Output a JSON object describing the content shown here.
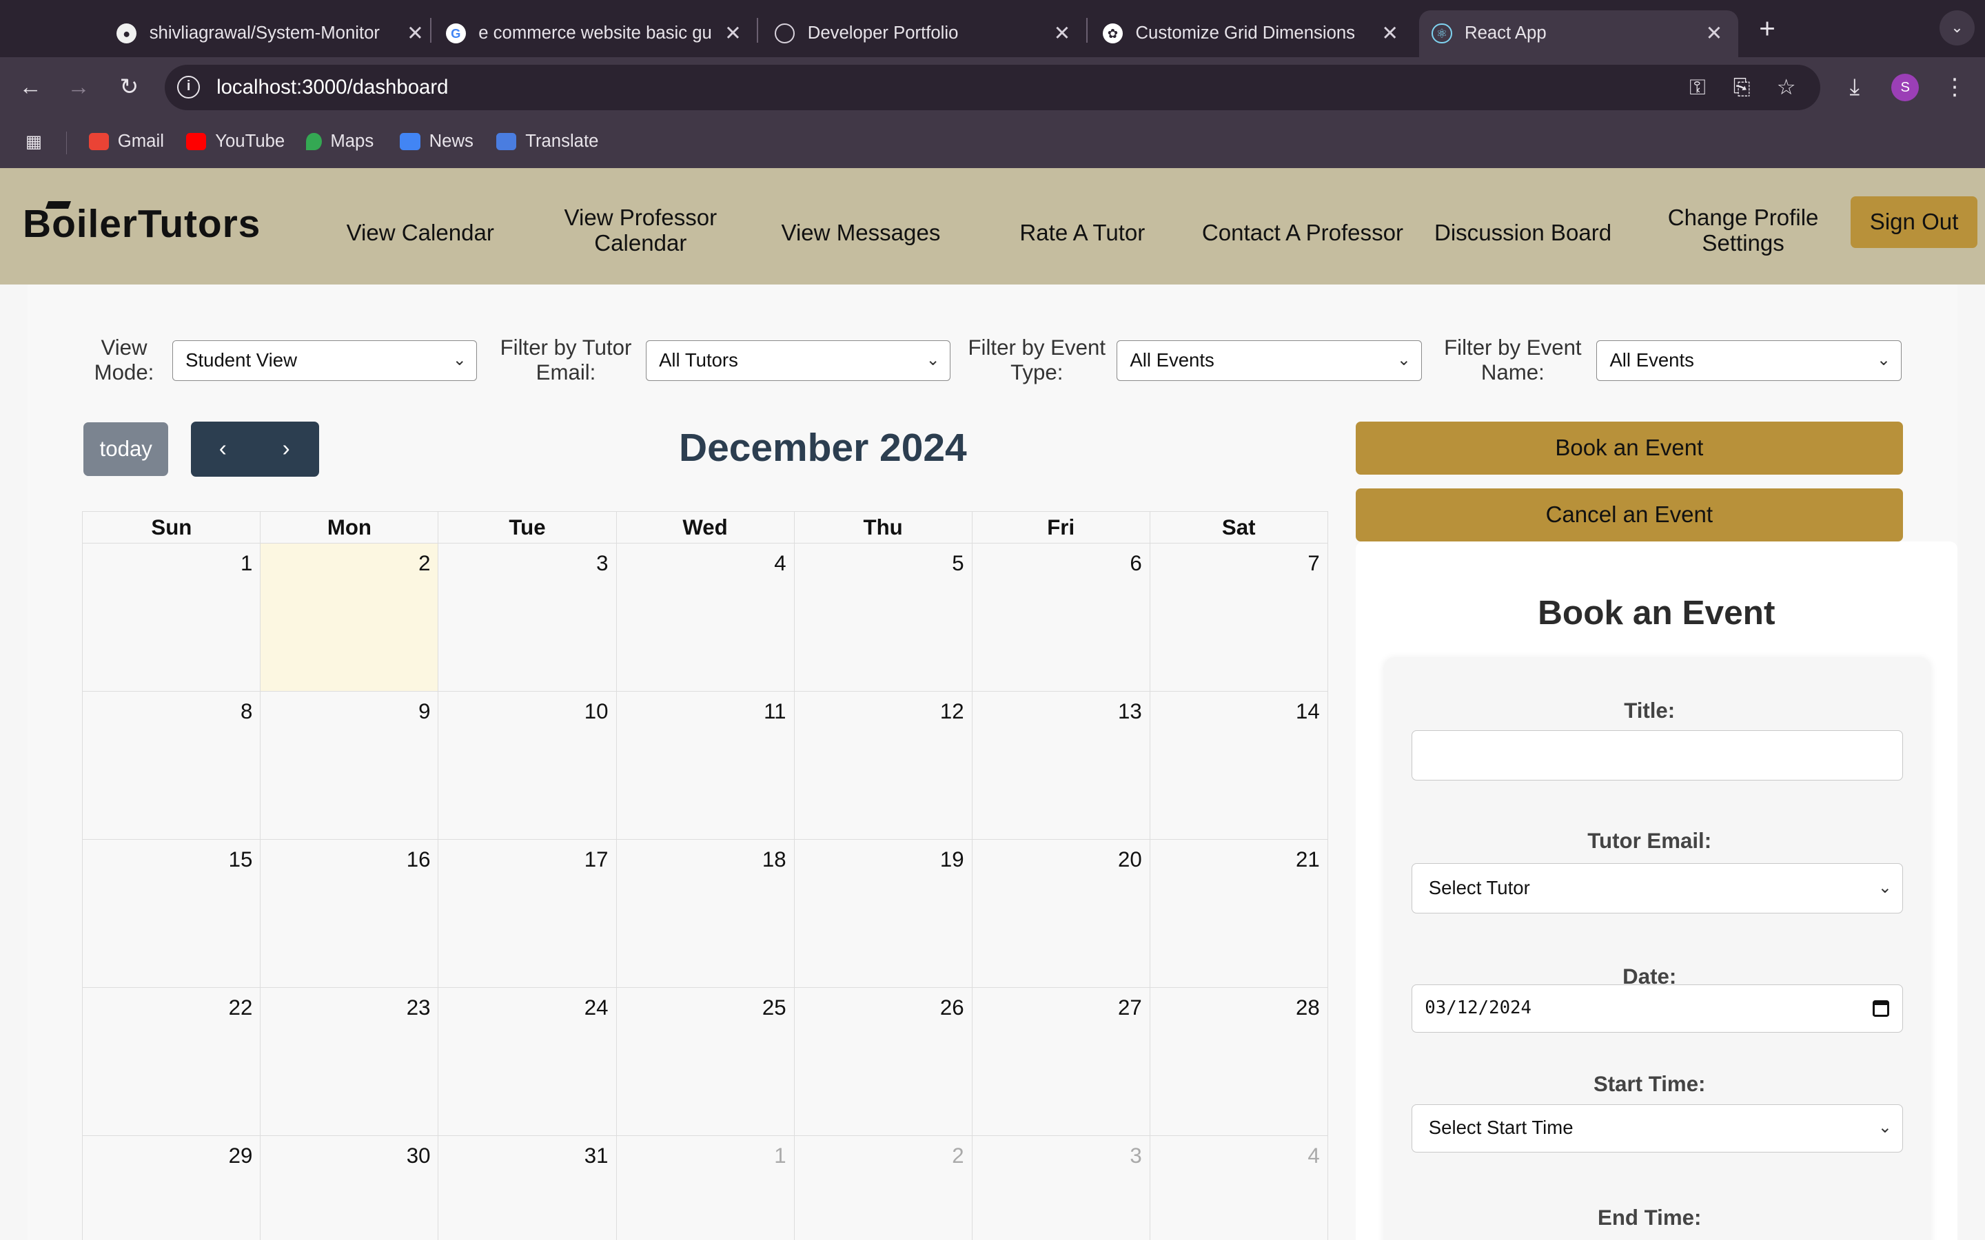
{
  "browser": {
    "tabs": [
      {
        "title": "shivliagrawal/System-Monitor",
        "icon": "github-icon"
      },
      {
        "title": "e commerce website basic gu",
        "icon": "google-icon"
      },
      {
        "title": "Developer Portfolio",
        "icon": "globe-icon"
      },
      {
        "title": "Customize Grid Dimensions",
        "icon": "openai-icon"
      },
      {
        "title": "React App",
        "icon": "react-icon",
        "active": true
      }
    ],
    "url": "localhost:3000/dashboard",
    "profile_initial": "S",
    "bookmarks": [
      "Gmail",
      "YouTube",
      "Maps",
      "News",
      "Translate"
    ]
  },
  "app": {
    "logo": "BoilerTutors",
    "nav": [
      "View Calendar",
      "View Professor Calendar",
      "View Messages",
      "Rate A Tutor",
      "Contact A Professor",
      "Discussion Board",
      "Change Profile Settings"
    ],
    "sign_out": "Sign Out",
    "accent_color": "#b8913a",
    "header_color": "#c5bd9f"
  },
  "filters": {
    "view_mode_label": "View Mode:",
    "view_mode_value": "Student View",
    "tutor_label": "Filter by Tutor Email:",
    "tutor_value": "All Tutors",
    "event_type_label": "Filter by Event Type:",
    "event_type_value": "All Events",
    "event_name_label": "Filter by Event Name:",
    "event_name_value": "All Events"
  },
  "calendar": {
    "today_label": "today",
    "title": "December 2024",
    "weekdays": [
      "Sun",
      "Mon",
      "Tue",
      "Wed",
      "Thu",
      "Fri",
      "Sat"
    ],
    "days": [
      "1",
      "2",
      "3",
      "4",
      "5",
      "6",
      "7",
      "8",
      "9",
      "10",
      "11",
      "12",
      "13",
      "14",
      "15",
      "16",
      "17",
      "18",
      "19",
      "20",
      "21",
      "22",
      "23",
      "24",
      "25",
      "26",
      "27",
      "28",
      "29",
      "30",
      "31",
      "1",
      "2",
      "3",
      "4"
    ],
    "highlighted_day": "2"
  },
  "actions": {
    "book": "Book an Event",
    "cancel": "Cancel an Event"
  },
  "form": {
    "heading": "Book an Event",
    "title_label": "Title:",
    "title_value": "",
    "tutor_label": "Tutor Email:",
    "tutor_value": "Select Tutor",
    "date_label": "Date:",
    "date_value": "03/12/2024",
    "start_label": "Start Time:",
    "start_value": "Select Start Time",
    "end_label": "End Time:"
  }
}
